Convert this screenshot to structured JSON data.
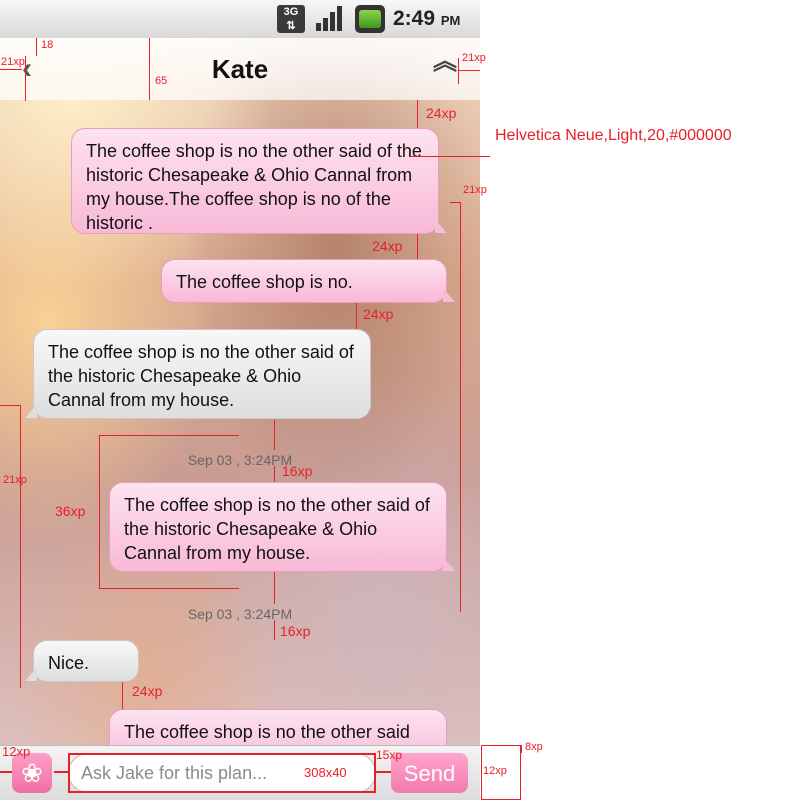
{
  "status_bar": {
    "network": "3G",
    "time": "2:49",
    "ampm": "PM"
  },
  "header": {
    "title": "Kate"
  },
  "messages": [
    {
      "text": "The coffee shop is no the other said of the historic Chesapeake & Ohio Cannal from my house.The coffee shop is no of the historic .",
      "sender": "me"
    },
    {
      "text": "The coffee shop is no.",
      "sender": "me"
    },
    {
      "text": "The coffee shop is no the other said of the historic Chesapeake & Ohio Cannal from my house.",
      "sender": "them"
    },
    {
      "text": "The coffee shop is no the other said of the historic Chesapeake & Ohio Cannal from my house.",
      "sender": "me"
    },
    {
      "text": "Nice.",
      "sender": "them"
    },
    {
      "text": "The coffee shop is no the other said",
      "sender": "me"
    }
  ],
  "timestamps": [
    "Sep 03 , 3:24PM",
    "Sep 03 , 3:24PM"
  ],
  "input_bar": {
    "placeholder": "Ask Jake for this plan...",
    "send_label": "Send"
  },
  "annotations": {
    "font_spec": "Helvetica Neue,Light,20,#000000",
    "top_18": "18",
    "left_21xp": "21xp",
    "nav_65": "65",
    "right_21xp": "21xp",
    "gap_24xp_1": "24xp",
    "side_21xp": "21xp",
    "gap_24xp_2": "24xp",
    "gap_24xp_3": "24xp",
    "left_21xp_2": "21xp",
    "bubble_36xp": "36xp",
    "gap_16xp_1": "16xp",
    "gap_16xp_2": "16xp",
    "gap_24xp_4": "24xp",
    "input_12xp": "12xp",
    "input_size": "308x40",
    "send_15xp": "15xp",
    "send_8xp": "8xp",
    "send_12xp": "12xp"
  },
  "colors": {
    "accent_pink": "#f27aad",
    "annotation_red": "#e8202a"
  }
}
